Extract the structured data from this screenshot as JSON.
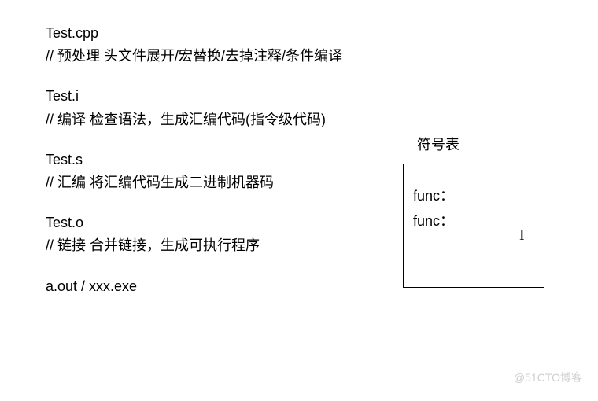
{
  "stages": [
    {
      "name": "Test.cpp",
      "desc": "// 预处理   头文件展开/宏替换/去掉注释/条件编译"
    },
    {
      "name": "Test.i",
      "desc": "// 编译   检查语法，生成汇编代码(指令级代码)"
    },
    {
      "name": "Test.s",
      "desc": "// 汇编   将汇编代码生成二进制机器码"
    },
    {
      "name": "Test.o",
      "desc": "// 链接   合并链接，生成可执行程序"
    },
    {
      "name": "a.out / xxx.exe",
      "desc": ""
    }
  ],
  "symbol_table": {
    "label": "符号表",
    "entries": [
      "func：",
      "func："
    ]
  },
  "cursor": "I",
  "watermark": "@51CTO博客"
}
